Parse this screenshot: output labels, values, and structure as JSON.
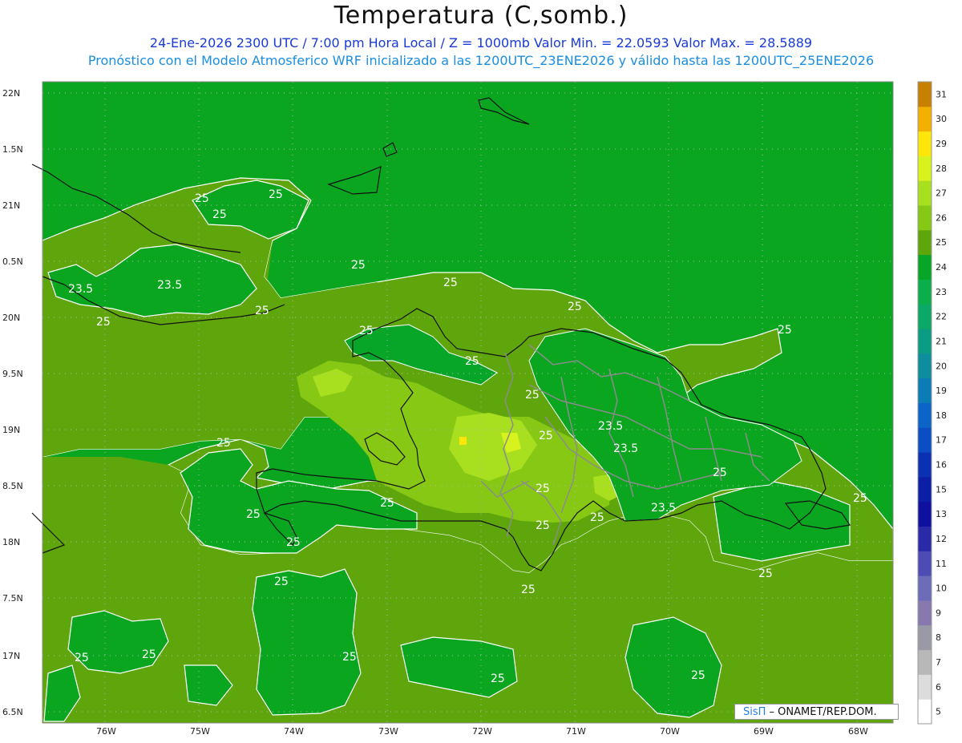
{
  "title": "Temperatura (C,somb.)",
  "subtitle_line1": "24-Ene-2026  2300 UTC / 7:00 pm Hora Local / Z = 1000mb    Valor Min. = 22.0593  Valor Max. = 28.5889",
  "subtitle_line2": "Pronóstico con el Modelo Atmosferico WRF inicializado a las 1200UTC_23ENE2026 y válido hasta las  1200UTC_25ENE2026",
  "credit": {
    "logo": "SisΠ",
    "text": " – ONAMET/REP.DOM."
  },
  "lat_labels": [
    "22N",
    "1.5N",
    "21N",
    "0.5N",
    "20N",
    "9.5N",
    "19N",
    "8.5N",
    "18N",
    "7.5N",
    "17N",
    "6.5N"
  ],
  "lon_labels": [
    "76W",
    "75W",
    "74W",
    "73W",
    "72W",
    "71W",
    "70W",
    "69W",
    "68W"
  ],
  "colorbar": {
    "levels": [
      "5",
      "6",
      "7",
      "8",
      "9",
      "10",
      "11",
      "12",
      "13",
      "15",
      "16",
      "17",
      "18",
      "19",
      "20",
      "21",
      "22",
      "23",
      "24",
      "25",
      "26",
      "27",
      "28",
      "29",
      "30",
      "31"
    ],
    "colors": [
      "#ffffff",
      "#dcdcdc",
      "#b8b8b8",
      "#9a9aa6",
      "#8878b0",
      "#6c6cb8",
      "#4c4cb4",
      "#2a2aa8",
      "#1010a0",
      "#0c1ea6",
      "#0a30b4",
      "#0b4ec4",
      "#0c64c8",
      "#0c7cb6",
      "#0c8e9e",
      "#0c9c84",
      "#0ca868",
      "#0cae4c",
      "#08a628",
      "#5ea60c",
      "#86c814",
      "#a8e020",
      "#d8f21e",
      "#ffe60a",
      "#f4b000",
      "#c88000"
    ]
  },
  "contour_labels": [
    {
      "text": "25"
    },
    {
      "text": "25"
    },
    {
      "text": "25"
    },
    {
      "text": "23.5"
    },
    {
      "text": "23.5"
    },
    {
      "text": "25"
    },
    {
      "text": "25"
    },
    {
      "text": "25"
    },
    {
      "text": "25"
    },
    {
      "text": "25"
    },
    {
      "text": "25"
    },
    {
      "text": "25"
    },
    {
      "text": "23.5"
    },
    {
      "text": "23.5"
    },
    {
      "text": "25"
    },
    {
      "text": "23.5"
    },
    {
      "text": "25"
    },
    {
      "text": "25"
    },
    {
      "text": "25"
    },
    {
      "text": "25"
    },
    {
      "text": "25"
    },
    {
      "text": "25"
    },
    {
      "text": "25"
    },
    {
      "text": "25"
    },
    {
      "text": "25"
    },
    {
      "text": "25"
    },
    {
      "text": "25"
    },
    {
      "text": "25"
    },
    {
      "text": "25"
    },
    {
      "text": "25"
    },
    {
      "text": "25"
    },
    {
      "text": "25"
    },
    {
      "text": "25"
    },
    {
      "text": "25"
    },
    {
      "text": "25"
    }
  ]
}
